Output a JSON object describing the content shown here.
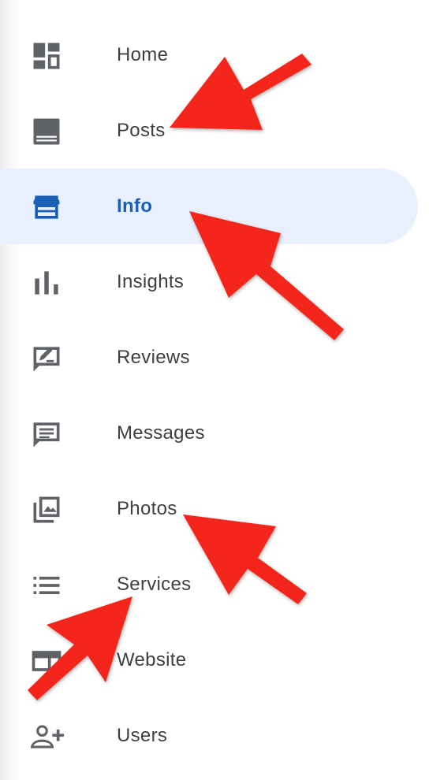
{
  "nav": {
    "items": [
      {
        "label": "Home",
        "icon": "dashboard-icon"
      },
      {
        "label": "Posts",
        "icon": "posts-icon"
      },
      {
        "label": "Info",
        "icon": "storefront-icon",
        "active": true
      },
      {
        "label": "Insights",
        "icon": "bar-chart-icon"
      },
      {
        "label": "Reviews",
        "icon": "rate-review-icon"
      },
      {
        "label": "Messages",
        "icon": "message-icon"
      },
      {
        "label": "Photos",
        "icon": "photo-library-icon"
      },
      {
        "label": "Services",
        "icon": "list-icon"
      },
      {
        "label": "Website",
        "icon": "web-icon"
      },
      {
        "label": "Users",
        "icon": "person-add-icon"
      }
    ]
  },
  "colors": {
    "active_bg": "#e8f0fe",
    "active_text": "#1a5fb4",
    "text": "#3c4043",
    "icon": "#5f6368",
    "arrow": "#f4281e"
  }
}
